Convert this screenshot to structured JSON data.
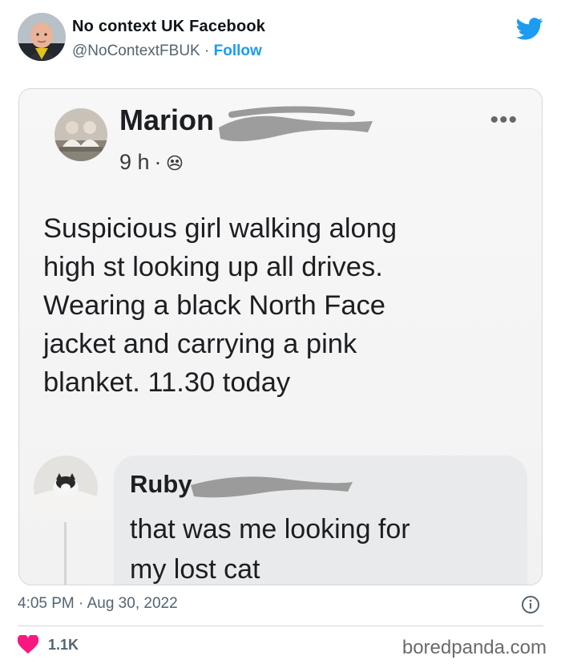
{
  "tweet": {
    "display_name": "No context UK Facebook",
    "handle": "@NoContextFBUK",
    "separator": " · ",
    "follow_label": "Follow",
    "avatar_icon": "user-avatar-icon",
    "brand_icon": "twitter-bird-icon",
    "brand_color": "#1d9bf0",
    "timestamp": "4:05 PM · Aug 30, 2022",
    "info_icon": "info-icon",
    "like_icon": "heart-icon",
    "like_color": "#f91880",
    "like_count": "1.1K"
  },
  "screenshot": {
    "post": {
      "author": "Marion",
      "time": "9 h",
      "meta_separator": " · ",
      "audience_icon": "friends-icon",
      "more_icon": "more-dots-icon",
      "more_label": "•••",
      "lines": [
        "Suspicious girl walking along",
        "high st looking up all drives.",
        "Wearing a black North Face",
        "jacket and carrying a pink",
        "blanket. 11.30 today"
      ]
    },
    "comment": {
      "author": "Ruby",
      "lines": [
        "that was me looking for",
        "my lost cat"
      ]
    }
  },
  "watermark": "boredpanda.com"
}
